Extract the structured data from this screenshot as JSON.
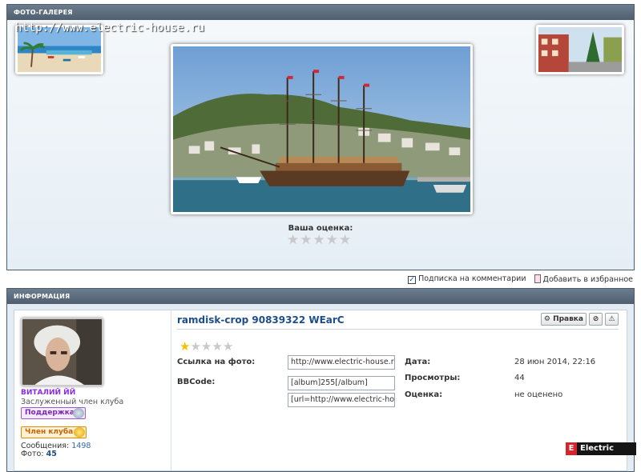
{
  "gallery": {
    "title": "ФОТО-ГАЛЕРЕЯ",
    "watermark": "http://www.electric-house.ru",
    "rating_title": "Ваша оценка:",
    "stars": 5
  },
  "subscription": {
    "subscribe_label": "Подписка на комментарии",
    "favorite_label": "Добавить в избранное"
  },
  "info": {
    "title": "ИНФОРМАЦИЯ",
    "user": {
      "name": "ВИТАЛИЙ ЙЙ",
      "rank": "Заслуженный член клуба",
      "badge_support": "Поддержка",
      "badge_member": "Член клуба",
      "messages_label": "Сообщения:",
      "messages_value": "1498",
      "photos_label": "Фото:",
      "photos_value": "45"
    },
    "photo": {
      "title": "ramdisk-crop 90839322 WEarC",
      "edit_label": "Правка",
      "link_label": "Ссылка на фото:",
      "link_value": "http://www.electric-house.ru/",
      "bbcode_label": "BBCode:",
      "bbcode_value1": "[album]255[/album]",
      "bbcode_value2": "[url=http://www.electric-house.ru",
      "date_label": "Дата:",
      "date_value": "28 июн 2014, 22:16",
      "views_label": "Просмотры:",
      "views_value": "44",
      "rating_label": "Оценка:",
      "rating_value": "не оценено",
      "rating_stars_filled": 1,
      "rating_stars_total": 5
    }
  },
  "branding": {
    "logo_letter": "E",
    "logo_text": "Electric House"
  },
  "colors": {
    "panel_header": "#56677a",
    "accent_link": "#1d4e89",
    "username": "#8a2be2"
  }
}
